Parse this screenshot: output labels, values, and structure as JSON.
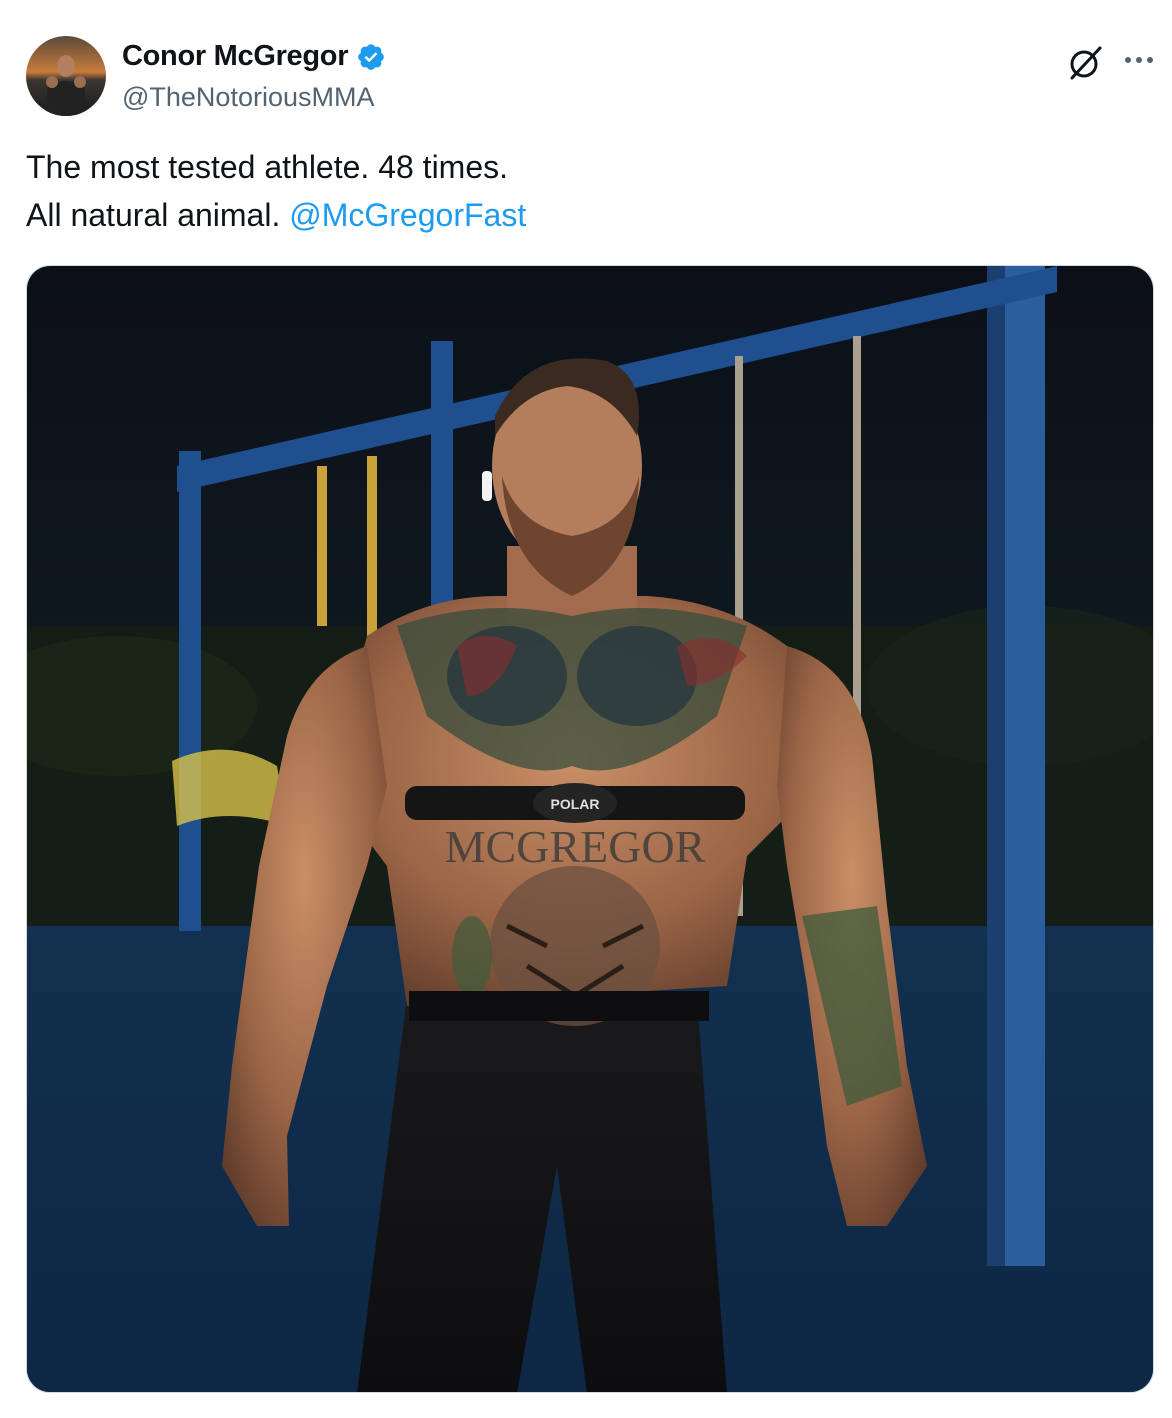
{
  "author": {
    "display_name": "Conor McGregor",
    "handle": "@TheNotoriousMMA",
    "verified": true,
    "verified_color": "#1d9bf0"
  },
  "tweet": {
    "line1": "The most tested athlete. 48 times.",
    "line2_prefix": "All natural animal. ",
    "mention": "@McGregorFast"
  },
  "media": {
    "strap_brand": "POLAR",
    "tattoo_text": "MCGREGOR"
  },
  "icons": {
    "grok": "grok-icon",
    "more": "more-icon",
    "verified": "verified-badge-icon"
  },
  "colors": {
    "link": "#1d9bf0",
    "text": "#0f1419",
    "secondary": "#536471"
  }
}
